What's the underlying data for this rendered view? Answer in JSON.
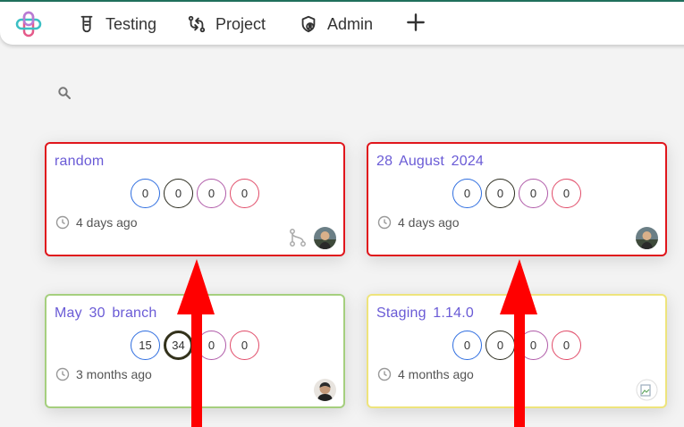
{
  "nav": {
    "items": [
      {
        "label": "Testing",
        "icon": "flask-icon"
      },
      {
        "label": "Project",
        "icon": "git-compare-icon"
      },
      {
        "label": "Admin",
        "icon": "shield-user-icon"
      }
    ],
    "add_icon": "plus-icon"
  },
  "search": {
    "icon": "search-icon"
  },
  "cards": [
    {
      "title": "random",
      "counts": [
        "0",
        "0",
        "0",
        "0"
      ],
      "time": "4 days ago",
      "border": "#e0161c"
    },
    {
      "title": "28 August 2024",
      "counts": [
        "0",
        "0",
        "0",
        "0"
      ],
      "time": "4 days ago",
      "border": "#e0161c"
    },
    {
      "title": "May 30 branch",
      "counts": [
        "15",
        "34",
        "0",
        "0"
      ],
      "time": "3 months ago",
      "border": "#a5cf7e"
    },
    {
      "title": "Staging 1.14.0",
      "counts": [
        "0",
        "0",
        "0",
        "0"
      ],
      "time": "4 months ago",
      "border": "#eee47c"
    }
  ],
  "colors": {
    "accent_title": "#6a5bd6",
    "arrow": "#ff0000",
    "topbar_border": "#1f6f5c"
  }
}
